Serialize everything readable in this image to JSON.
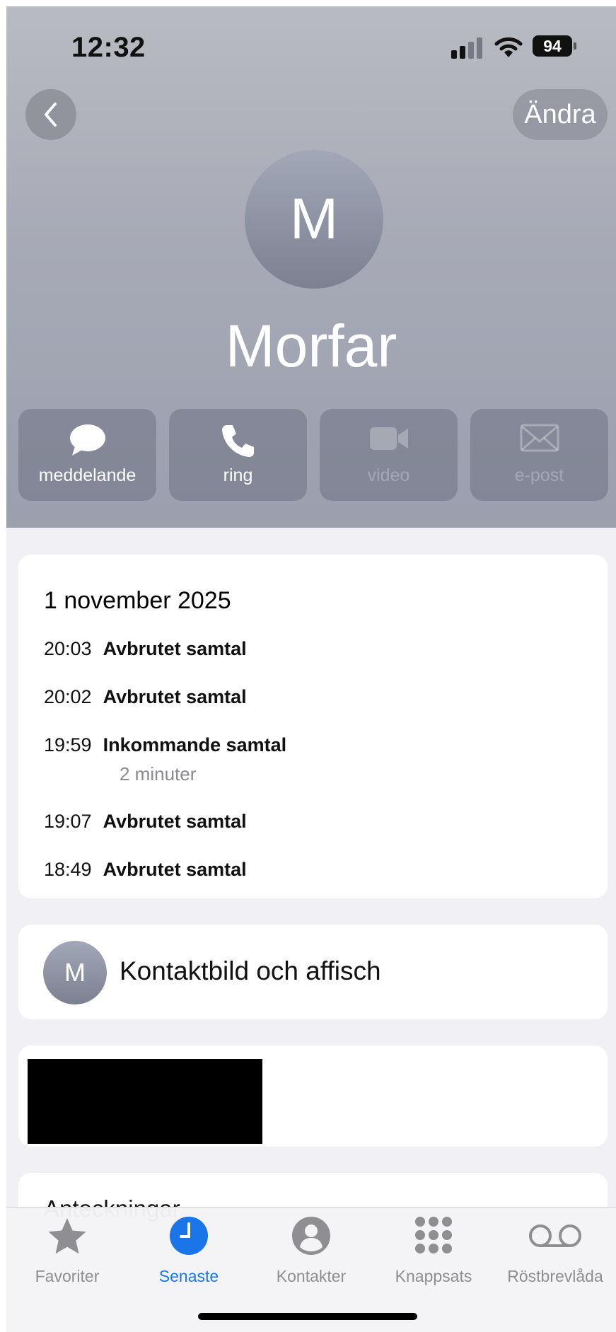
{
  "status_bar": {
    "time": "12:32",
    "battery": "94"
  },
  "nav": {
    "edit_label": "Ändra"
  },
  "contact": {
    "initial": "M",
    "name": "Morfar"
  },
  "actions": [
    {
      "label": "meddelande",
      "icon": "message-bubble-icon",
      "enabled": true
    },
    {
      "label": "ring",
      "icon": "phone-icon",
      "enabled": true
    },
    {
      "label": "video",
      "icon": "video-camera-icon",
      "enabled": false
    },
    {
      "label": "e-post",
      "icon": "envelope-icon",
      "enabled": false
    }
  ],
  "call_history": {
    "date": "1 november 2025",
    "calls": [
      {
        "time": "20:03",
        "type": "Avbrutet samtal"
      },
      {
        "time": "20:02",
        "type": "Avbrutet samtal"
      },
      {
        "time": "19:59",
        "type": "Inkommande samtal",
        "duration": "2 minuter"
      },
      {
        "time": "19:07",
        "type": "Avbrutet samtal"
      },
      {
        "time": "18:49",
        "type": "Avbrutet samtal"
      }
    ]
  },
  "contact_photo": {
    "initial": "M",
    "label": "Kontaktbild och affisch"
  },
  "notes": {
    "label": "Anteckningar"
  },
  "tabbar": {
    "active": "Senaste",
    "tabs": [
      {
        "label": "Favoriter",
        "icon": "star-icon"
      },
      {
        "label": "Senaste",
        "icon": "clock-icon"
      },
      {
        "label": "Kontakter",
        "icon": "person-circle-icon"
      },
      {
        "label": "Knappsats",
        "icon": "keypad-icon"
      },
      {
        "label": "Röstbrevlåda",
        "icon": "voicemail-icon"
      }
    ]
  },
  "colors": {
    "accent": "#1a75e8",
    "header_top": "#b9bbc2",
    "header_bottom": "#9b9fae"
  }
}
